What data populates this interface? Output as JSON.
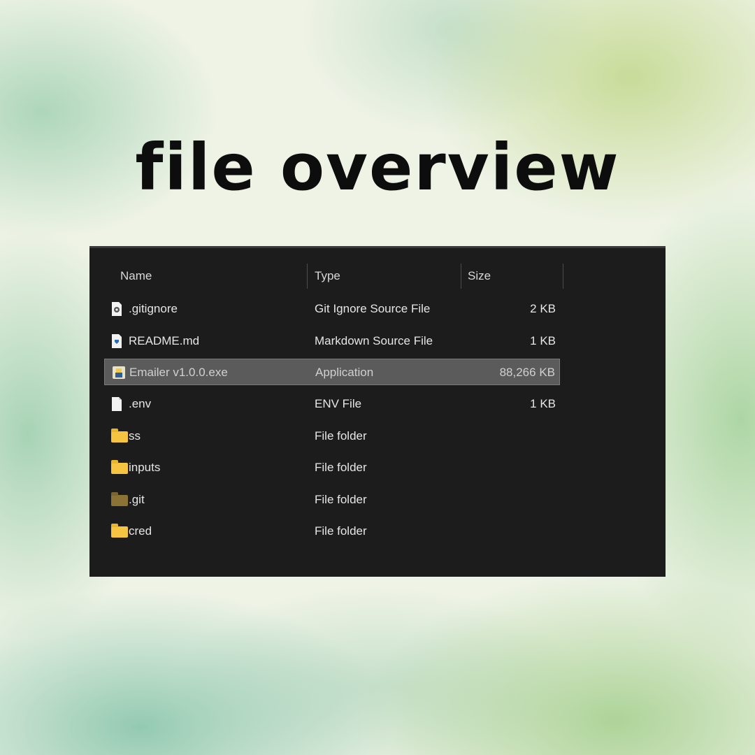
{
  "title": "file overview",
  "explorer": {
    "columns": {
      "name": "Name",
      "type": "Type",
      "size": "Size"
    },
    "rows": [
      {
        "name": ".gitignore",
        "type": "Git Ignore Source File",
        "size": "2 KB",
        "icon": "gitignore-file-icon"
      },
      {
        "name": "README.md",
        "type": "Markdown Source File",
        "size": "1 KB",
        "icon": "markdown-file-icon"
      },
      {
        "name": "Emailer v1.0.0.exe",
        "type": "Application",
        "size": "88,266 KB",
        "icon": "application-icon",
        "selected": true
      },
      {
        "name": ".env",
        "type": "ENV File",
        "size": "1 KB",
        "icon": "blank-file-icon"
      },
      {
        "name": "ss",
        "type": "File folder",
        "size": "",
        "icon": "folder-icon"
      },
      {
        "name": "inputs",
        "type": "File folder",
        "size": "",
        "icon": "folder-icon"
      },
      {
        "name": ".git",
        "type": "File folder",
        "size": "",
        "icon": "hidden-folder-icon"
      },
      {
        "name": "cred",
        "type": "File folder",
        "size": "",
        "icon": "folder-icon"
      }
    ]
  },
  "colors": {
    "explorer_bg": "#1c1c1c",
    "selection": "#5b5b5b",
    "folder": "#f5c542"
  }
}
